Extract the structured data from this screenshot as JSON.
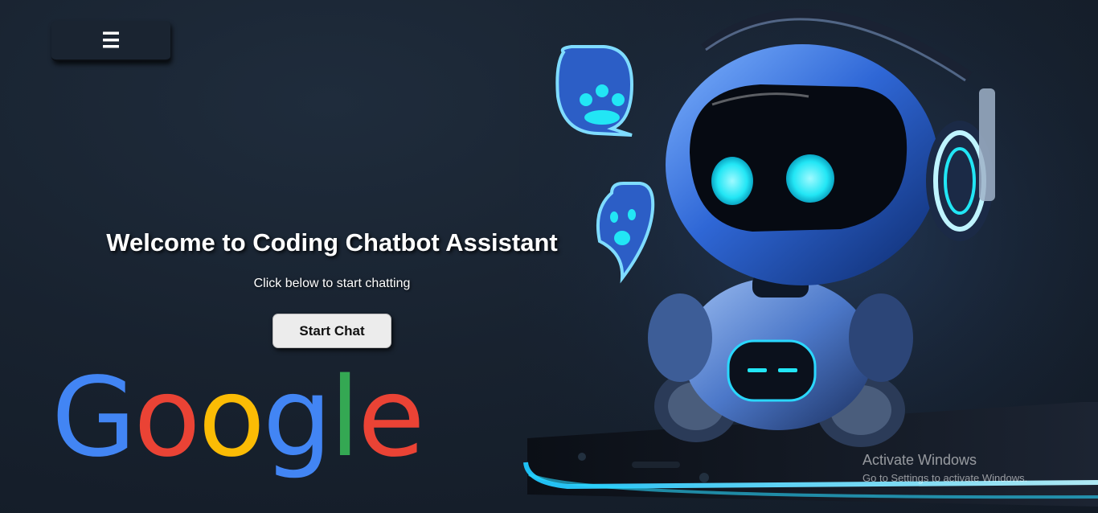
{
  "menu": {
    "icon": "hamburger-menu-icon",
    "label": "☰"
  },
  "hero": {
    "title": "Welcome to Coding Chatbot Assistant",
    "subtitle": "Click below to start chatting",
    "cta_label": "Start Chat"
  },
  "google_logo": {
    "text": "Google",
    "letters": [
      {
        "char": "G",
        "color": "#4285F4"
      },
      {
        "char": "o",
        "color": "#EA4335"
      },
      {
        "char": "o",
        "color": "#FBBC05"
      },
      {
        "char": "g",
        "color": "#4285F4"
      },
      {
        "char": "l",
        "color": "#34A853"
      },
      {
        "char": "e",
        "color": "#EA4335"
      }
    ]
  },
  "watermark": {
    "title": "Activate Windows",
    "subtitle": "Go to Settings to activate Windows."
  },
  "colors": {
    "background": "#18222f",
    "robot_glow": "#22e6f5",
    "robot_body": "#3a6fd8"
  }
}
